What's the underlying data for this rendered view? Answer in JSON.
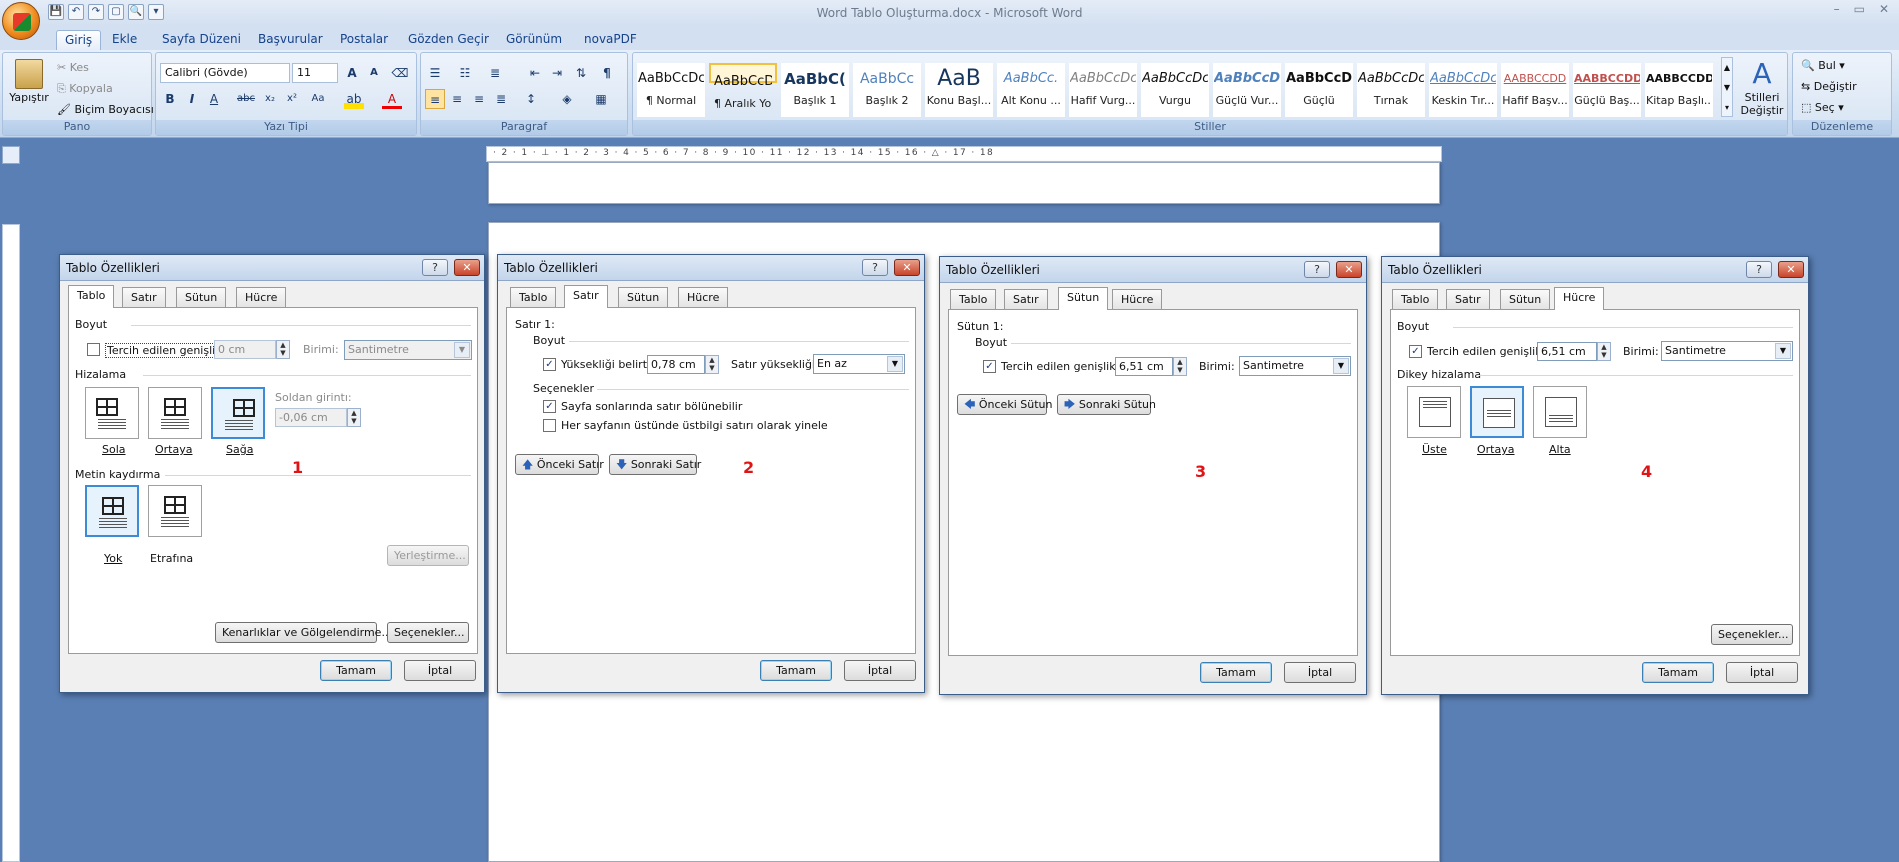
{
  "window": {
    "title": "Word Tablo Oluşturma.docx - Microsoft Word",
    "controls": [
      "–",
      "▭",
      "✕"
    ]
  },
  "qat": [
    "💾",
    "↶",
    "↷",
    "▢",
    "🔍",
    "▾"
  ],
  "tabs": [
    "Giriş",
    "Ekle",
    "Sayfa Düzeni",
    "Başvurular",
    "Postalar",
    "Gözden Geçir",
    "Görünüm",
    "novaPDF"
  ],
  "ribbon": {
    "pano": {
      "label": "Pano",
      "paste": "Yapıştır",
      "cut": "Kes",
      "copy": "Kopyala",
      "painter": "Biçim Boyacısı"
    },
    "font": {
      "label": "Yazı Tipi",
      "name": "Calibri (Gövde)",
      "size": "11"
    },
    "paragraph": {
      "label": "Paragraf"
    },
    "styles": {
      "label": "Stiller",
      "change": "Stilleri Değiştir",
      "items": [
        {
          "preview": "AaBbCcDc",
          "name": "¶ Normal"
        },
        {
          "preview": "AaBbCcDc",
          "name": "¶ Aralık Yok"
        },
        {
          "preview": "AaBbC(",
          "name": "Başlık 1"
        },
        {
          "preview": "AaBbCc",
          "name": "Başlık 2"
        },
        {
          "preview": "AaB",
          "name": "Konu Başl..."
        },
        {
          "preview": "AaBbCc.",
          "name": "Alt Konu ..."
        },
        {
          "preview": "AaBbCcDc",
          "name": "Hafif Vurg..."
        },
        {
          "preview": "AaBbCcDc",
          "name": "Vurgu"
        },
        {
          "preview": "AaBbCcDc",
          "name": "Güçlü Vur..."
        },
        {
          "preview": "AaBbCcDc",
          "name": "Güçlü"
        },
        {
          "preview": "AaBbCcDc",
          "name": "Tırnak"
        },
        {
          "preview": "AaBbCcDc",
          "name": "Keskin Tır..."
        },
        {
          "preview": "AABBCCDD",
          "name": "Hafif Başv..."
        },
        {
          "preview": "AABBCCDD",
          "name": "Güçlü Baş..."
        },
        {
          "preview": "AABBCCDD",
          "name": "Kitap Başlı..."
        }
      ]
    },
    "editing": {
      "label": "Düzenleme",
      "find": "Bul",
      "replace": "Değiştir",
      "select": "Seç"
    }
  },
  "ruler": "· 2 · 1 · ⊥ · 1 · 2 · 3 · 4 · 5 · 6 · 7 · 8 · 9 · 10 · 11 · 12 · 13 · 14 · 15 · 16 · △ · 17 · 18",
  "dlg_title": "Tablo Özellikleri",
  "dlg_tabs": [
    "Tablo",
    "Satır",
    "Sütun",
    "Hücre"
  ],
  "ok": "Tamam",
  "cancel": "İptal",
  "help": "?",
  "close": "✕",
  "d1": {
    "boyut": "Boyut",
    "pref": "Tercih edilen genişlik:",
    "pref_val": "0 cm",
    "unit": "Birimi:",
    "unit_val": "Santimetre",
    "hizalama": "Hizalama",
    "left": "Sola",
    "center": "Ortaya",
    "right": "Sağa",
    "indent": "Soldan girintı:",
    "indent_val": "-0,06 cm",
    "wrap": "Metin kaydırma",
    "none": "Yok",
    "around": "Etrafına",
    "position": "Yerleştirme...",
    "borders": "Kenarlıklar ve Gölgelendirme...",
    "options": "Seçenekler...",
    "num": "1"
  },
  "d2": {
    "row": "Satır 1:",
    "boyut": "Boyut",
    "height": "Yüksekliği belirt:",
    "height_val": "0,78 cm",
    "mode": "Satır yüksekliği:",
    "mode_val": "En az",
    "sec": "Seçenekler",
    "opt1": "Sayfa sonlarında satır bölünebilir",
    "opt2": "Her sayfanın üstünde üstbilgi satırı olarak yinele",
    "prev": "Önceki Satır",
    "next": "Sonraki Satır",
    "num": "2"
  },
  "d3": {
    "col": "Sütun 1:",
    "boyut": "Boyut",
    "pref": "Tercih edilen genişlik:",
    "pref_val": "6,51 cm",
    "unit": "Birimi:",
    "unit_val": "Santimetre",
    "prev": "Önceki Sütun",
    "next": "Sonraki Sütun",
    "num": "3"
  },
  "d4": {
    "boyut": "Boyut",
    "pref": "Tercih edilen genişlik:",
    "pref_val": "6,51 cm",
    "unit": "Birimi:",
    "unit_val": "Santimetre",
    "valign": "Dikey hizalama",
    "top": "Üste",
    "middle": "Ortaya",
    "bottom": "Alta",
    "options": "Seçenekler...",
    "num": "4"
  }
}
